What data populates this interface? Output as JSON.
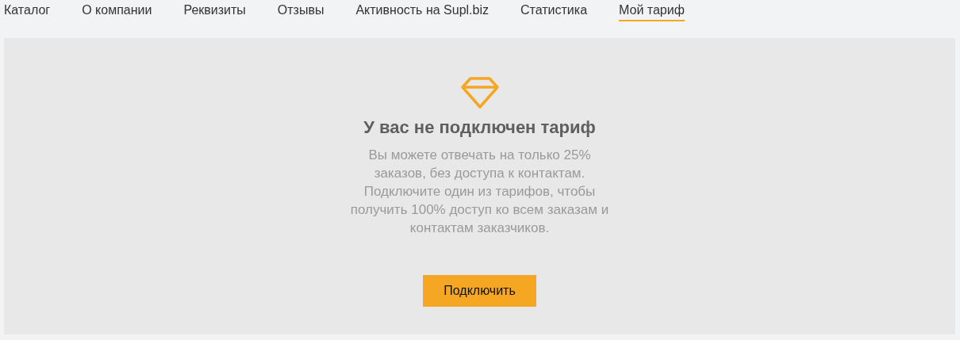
{
  "tabs": [
    {
      "label": "Каталог",
      "selected": false
    },
    {
      "label": "О компании",
      "selected": false
    },
    {
      "label": "Реквизиты",
      "selected": false
    },
    {
      "label": "Отзывы",
      "selected": false
    },
    {
      "label": "Активность на Supl.biz",
      "selected": false
    },
    {
      "label": "Статистика",
      "selected": false
    },
    {
      "label": "Мой тариф",
      "selected": true
    }
  ],
  "notice": {
    "title": "У вас не подключен тариф",
    "text": "Вы можете отвечать на только 25% заказов, без доступа к контактам. Подключите один из тарифов, чтобы получить 100% доступ ко всем заказам и контактам заказчиков.",
    "button": "Подключить"
  }
}
